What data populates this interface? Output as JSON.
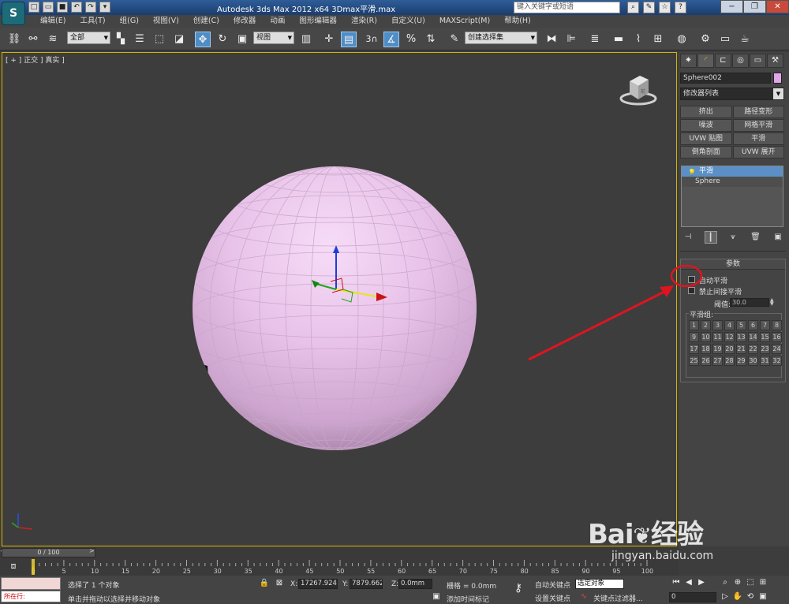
{
  "titlebar": {
    "app_title": "Autodesk 3ds Max  2012 x64       3Dmax平滑.max",
    "search_placeholder": "键入关键字或短语",
    "logo": "S",
    "quick_access_icons": [
      "new-file-icon",
      "open-folder-icon",
      "save-icon",
      "undo-icon",
      "redo-icon",
      "dropdown-icon"
    ],
    "window_buttons": [
      "minimize-icon",
      "restore-icon",
      "close-icon"
    ]
  },
  "menubar": {
    "items": [
      "编辑(E)",
      "工具(T)",
      "组(G)",
      "视图(V)",
      "创建(C)",
      "修改器",
      "动画",
      "图形编辑器",
      "渲染(R)",
      "自定义(U)",
      "MAXScript(M)",
      "帮助(H)"
    ]
  },
  "toolbar": {
    "selection_filter": "全部",
    "reference_coord": "视图",
    "named_selection": "创建选择集",
    "snap_label": "3"
  },
  "viewport": {
    "label": "[ + ] 正交 ] 真实 ]",
    "sphere_color": "#e2a6e8",
    "border_color": "#d8b400",
    "gizmo_axes": [
      "x",
      "y",
      "z"
    ],
    "viewcube_label": "前"
  },
  "command_panel": {
    "tab_icons": [
      "create-icon",
      "modify-icon",
      "hierarchy-icon",
      "motion-icon",
      "display-icon",
      "utilities-icon"
    ],
    "object_name": "Sphere002",
    "object_color": "#e2a6e8",
    "modifier_list": "修改器列表",
    "modifier_buttons": [
      "挤出",
      "路径变形",
      "噪波",
      "网格平滑",
      "UVW 贴图",
      "平滑",
      "倒角剖面",
      "UVW 展开"
    ],
    "stack": [
      "平滑",
      "Sphere"
    ],
    "rollout_title": "参数",
    "auto_smooth_label": "自动平滑",
    "prevent_indirect_label": "禁止间接平滑",
    "threshold_label": "阈值:",
    "threshold_value": "30.0",
    "smoothing_groups_label": "平滑组:",
    "smoothing_groups": [
      "1",
      "2",
      "3",
      "4",
      "5",
      "6",
      "7",
      "8",
      "9",
      "10",
      "11",
      "12",
      "13",
      "14",
      "15",
      "16",
      "17",
      "18",
      "19",
      "20",
      "21",
      "22",
      "23",
      "24",
      "25",
      "26",
      "27",
      "28",
      "29",
      "30",
      "31",
      "32"
    ]
  },
  "timeline": {
    "slider_label": "0 / 100",
    "ticks": [
      "0",
      "5",
      "10",
      "15",
      "20",
      "25",
      "30",
      "35",
      "40",
      "45",
      "50",
      "55",
      "60",
      "65",
      "70",
      "75",
      "80",
      "85",
      "90",
      "95",
      "100"
    ]
  },
  "statusbar": {
    "script_prompt": "所在行:",
    "selection_status": "选择了 1 个对象",
    "prompt_text": "单击并拖动以选择并移动对象",
    "x_label": "X:",
    "x_value": "17267.924",
    "y_label": "Y:",
    "y_value": "7879.662m",
    "z_label": "Z:",
    "z_value": "0.0mm",
    "grid_label": "栅格 = 0.0mm",
    "add_time_tag": "添加时间标记",
    "auto_key": "自动关键点",
    "set_key": "设置关键点",
    "selected_label": "选定对象",
    "key_filters": "关键点过滤器...",
    "frame_value": "0"
  },
  "watermark": {
    "brand": "Bai",
    "brand2": "经验",
    "url": "jingyan.baidu.com"
  },
  "annotation_color": "#e0141e"
}
